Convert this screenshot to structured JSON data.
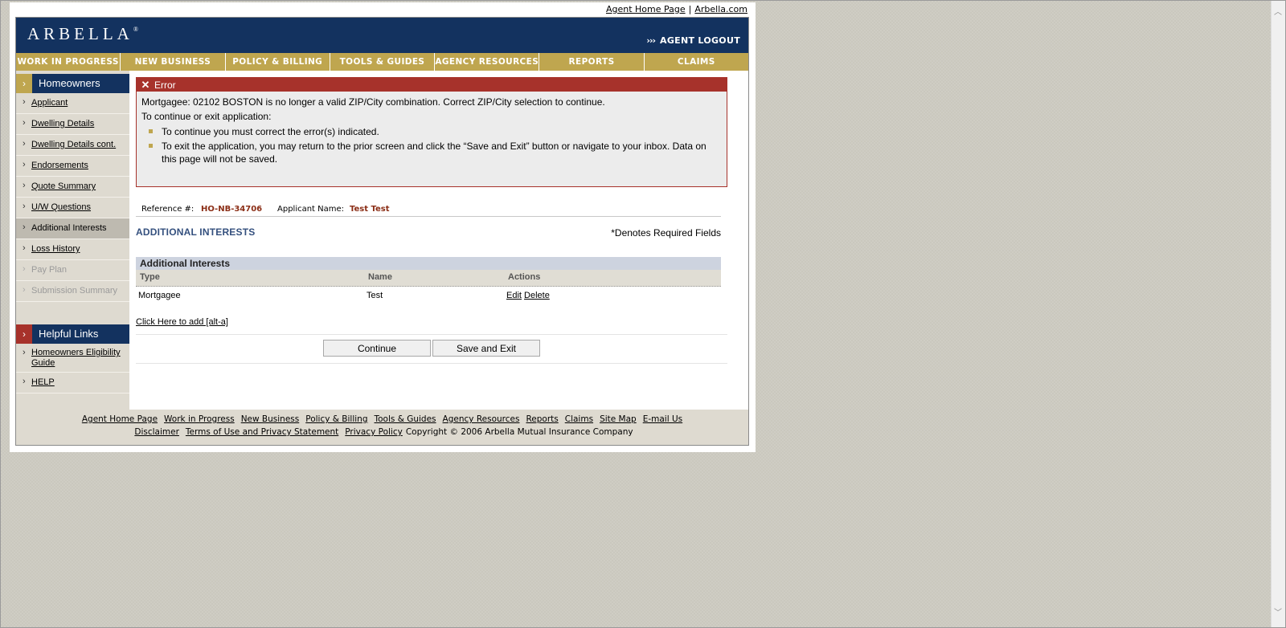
{
  "top_links": {
    "agent_home": "Agent Home Page",
    "separator": "|",
    "arbella": "Arbella.com"
  },
  "header": {
    "logo": "ARBELLA",
    "logo_mark": "®",
    "logout_chevrons": "›››",
    "logout": "AGENT LOGOUT"
  },
  "nav": [
    "WORK IN PROGRESS",
    "NEW BUSINESS",
    "POLICY & BILLING",
    "TOOLS & GUIDES",
    "AGENCY RESOURCES",
    "REPORTS",
    "CLAIMS"
  ],
  "sidebar": {
    "title": "Homeowners",
    "items": [
      {
        "label": "Applicant",
        "state": "link"
      },
      {
        "label": "Dwelling Details",
        "state": "link"
      },
      {
        "label": "Dwelling Details cont.",
        "state": "link"
      },
      {
        "label": "Endorsements",
        "state": "link"
      },
      {
        "label": "Quote Summary",
        "state": "link"
      },
      {
        "label": "U/W Questions",
        "state": "link"
      },
      {
        "label": "Additional Interests",
        "state": "active"
      },
      {
        "label": "Loss History",
        "state": "link"
      },
      {
        "label": "Pay Plan",
        "state": "disabled"
      },
      {
        "label": "Submission Summary",
        "state": "disabled"
      }
    ],
    "helpful_title": "Helpful Links",
    "helpful_items": [
      {
        "label": "Homeowners Eligibility Guide"
      },
      {
        "label": "HELP"
      }
    ]
  },
  "error": {
    "title": "Error",
    "message": "Mortgagee: 02102 BOSTON is no longer a valid ZIP/City combination. Correct ZIP/City selection to continue.",
    "sub": "To continue or exit application:",
    "bullets": [
      "To continue you must correct the error(s) indicated.",
      "To exit the application, you may return to the prior screen and click the “Save and Exit” button or navigate to your inbox. Data on this page will not be saved."
    ]
  },
  "reference": {
    "ref_label": "Reference #:",
    "ref_value": "HO-NB-34706",
    "name_label": "Applicant Name:",
    "name_value": "Test Test"
  },
  "section": {
    "title": "ADDITIONAL INTERESTS",
    "required_note": "*Denotes Required Fields"
  },
  "table": {
    "caption": "Additional Interests",
    "columns": [
      "Type",
      "Name",
      "Actions"
    ],
    "rows": [
      {
        "type": "Mortgagee",
        "name": "Test",
        "edit": "Edit",
        "delete": "Delete"
      }
    ]
  },
  "add_link": "Click Here to add [alt-a]",
  "buttons": {
    "continue": "Continue",
    "save_exit": "Save and Exit"
  },
  "footer": {
    "line1": [
      "Agent Home Page",
      "Work in Progress",
      "New Business",
      "Policy & Billing",
      "Tools & Guides",
      "Agency Resources",
      "Reports",
      "Claims",
      "Site Map",
      "E-mail Us"
    ],
    "line2_links": [
      "Disclaimer",
      "Terms of Use and Privacy Statement",
      "Privacy Policy"
    ],
    "copyright": "Copyright © 2006 Arbella Mutual Insurance Company"
  },
  "colors": {
    "navy": "#13325f",
    "gold": "#bfa64f",
    "error_red": "#a7322b",
    "reference_value": "#8b2e16"
  }
}
